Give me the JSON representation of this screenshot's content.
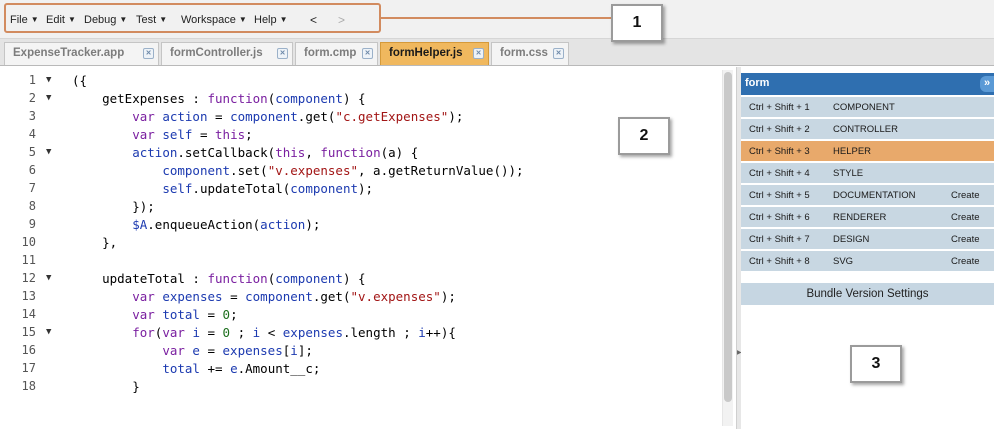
{
  "menu": {
    "items": [
      {
        "label": "File"
      },
      {
        "label": "Edit"
      },
      {
        "label": "Debug"
      },
      {
        "label": "Test"
      },
      {
        "label": "Workspace"
      },
      {
        "label": "Help"
      }
    ],
    "back_glyph": "<",
    "forward_glyph": ">"
  },
  "callouts": {
    "one": "1",
    "two": "2",
    "three": "3"
  },
  "tabs": [
    {
      "label": "ExpenseTracker.app",
      "active": false
    },
    {
      "label": "formController.js",
      "active": false
    },
    {
      "label": "form.cmp",
      "active": false
    },
    {
      "label": "formHelper.js",
      "active": true
    },
    {
      "label": "form.css",
      "active": false
    }
  ],
  "editor": {
    "line_numbers": [
      "1",
      "2",
      "3",
      "4",
      "5",
      "6",
      "7",
      "8",
      "9",
      "10",
      "11",
      "12",
      "13",
      "14",
      "15",
      "16",
      "17",
      "18"
    ],
    "fold_markers": [
      true,
      true,
      false,
      false,
      true,
      false,
      false,
      false,
      false,
      false,
      false,
      true,
      false,
      false,
      true,
      false,
      false,
      false
    ],
    "code_lines": [
      "({",
      "    getExpenses : function(component) {",
      "        var action = component.get(\"c.getExpenses\");",
      "        var self = this;",
      "        action.setCallback(this, function(a) {",
      "            component.set(\"v.expenses\", a.getReturnValue());",
      "            self.updateTotal(component);",
      "        });",
      "        $A.enqueueAction(action);",
      "    },",
      "",
      "    updateTotal : function(component) {",
      "        var expenses = component.get(\"v.expenses\");",
      "        var total = 0;",
      "        for(var i = 0 ; i < expenses.length ; i++){",
      "            var e = expenses[i];",
      "            total += e.Amount__c;",
      "        }"
    ]
  },
  "panel": {
    "title": "form",
    "collapse_glyph": "»",
    "rows": [
      {
        "shortcut": "Ctrl + Shift + 1",
        "name": "COMPONENT",
        "action": "",
        "active": false
      },
      {
        "shortcut": "Ctrl + Shift + 2",
        "name": "CONTROLLER",
        "action": "",
        "active": false
      },
      {
        "shortcut": "Ctrl + Shift + 3",
        "name": "HELPER",
        "action": "",
        "active": true
      },
      {
        "shortcut": "Ctrl + Shift + 4",
        "name": "STYLE",
        "action": "",
        "active": false
      },
      {
        "shortcut": "Ctrl + Shift + 5",
        "name": "DOCUMENTATION",
        "action": "Create",
        "active": false
      },
      {
        "shortcut": "Ctrl + Shift + 6",
        "name": "RENDERER",
        "action": "Create",
        "active": false
      },
      {
        "shortcut": "Ctrl + Shift + 7",
        "name": "DESIGN",
        "action": "Create",
        "active": false
      },
      {
        "shortcut": "Ctrl + Shift + 8",
        "name": "SVG",
        "action": "Create",
        "active": false
      }
    ],
    "bundle_settings": "Bundle Version Settings"
  },
  "colors": {
    "accent_tab": "#f0b85e",
    "panel_header": "#2f6fb0",
    "panel_row": "#c8d7e2",
    "panel_row_active": "#e8a96b",
    "callout_border": "#d28b5f"
  }
}
